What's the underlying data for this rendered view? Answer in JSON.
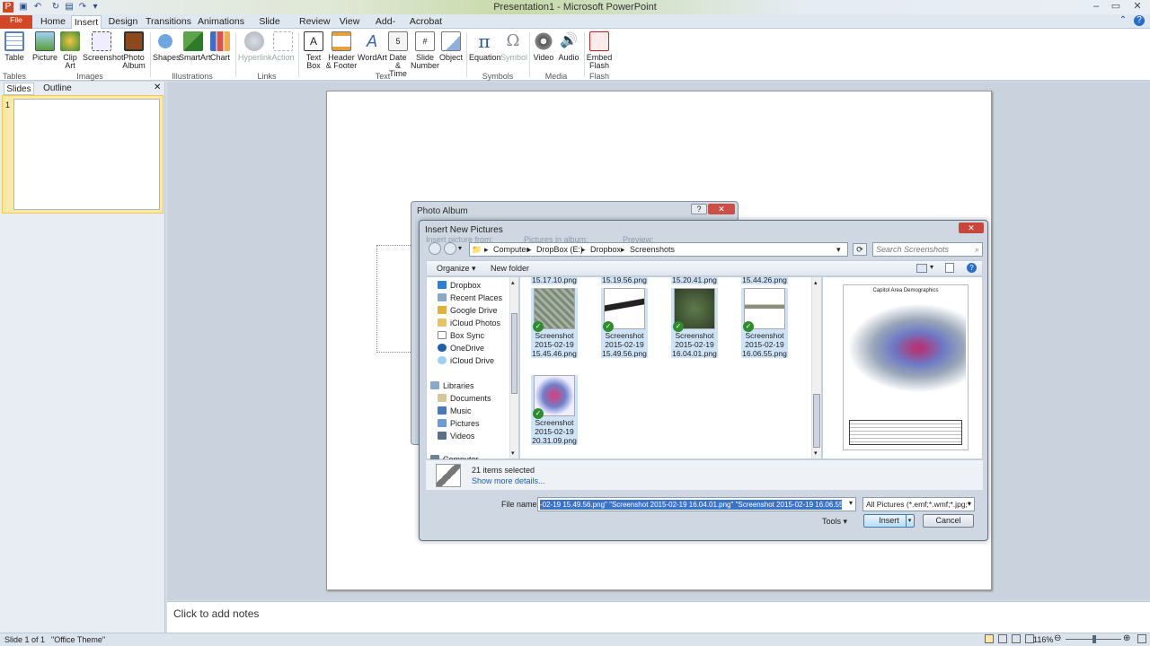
{
  "window": {
    "title": "Presentation1 - Microsoft PowerPoint"
  },
  "tabs": [
    "File",
    "Home",
    "Insert",
    "Design",
    "Transitions",
    "Animations",
    "Slide Show",
    "Review",
    "View",
    "Add-Ins",
    "Acrobat"
  ],
  "ribbon": {
    "buttons": [
      {
        "label": "Table",
        "sub": "",
        "icon": "table-icon"
      },
      {
        "label": "Picture",
        "sub": "",
        "icon": "picture-icon"
      },
      {
        "label": "Clip",
        "sub": "Art",
        "icon": "clip-art-icon"
      },
      {
        "label": "Screenshot",
        "sub": "",
        "icon": "screenshot-icon"
      },
      {
        "label": "Photo",
        "sub": "Album",
        "icon": "photo-album-icon"
      },
      {
        "label": "Shapes",
        "sub": "",
        "icon": "shapes-icon"
      },
      {
        "label": "SmartArt",
        "sub": "",
        "icon": "smartart-icon"
      },
      {
        "label": "Chart",
        "sub": "",
        "icon": "chart-icon"
      },
      {
        "label": "Hyperlink",
        "sub": "",
        "icon": "hyperlink-icon"
      },
      {
        "label": "Action",
        "sub": "",
        "icon": "action-icon"
      },
      {
        "label": "Text",
        "sub": "Box",
        "icon": "text-box-icon"
      },
      {
        "label": "Header",
        "sub": "& Footer",
        "icon": "header-footer-icon"
      },
      {
        "label": "WordArt",
        "sub": "",
        "icon": "wordart-icon"
      },
      {
        "label": "Date",
        "sub": "& Time",
        "icon": "date-time-icon"
      },
      {
        "label": "Slide",
        "sub": "Number",
        "icon": "slide-number-icon"
      },
      {
        "label": "Object",
        "sub": "",
        "icon": "object-icon"
      },
      {
        "label": "Equation",
        "sub": "",
        "icon": "equation-icon"
      },
      {
        "label": "Symbol",
        "sub": "",
        "icon": "symbol-icon"
      },
      {
        "label": "Video",
        "sub": "",
        "icon": "video-icon"
      },
      {
        "label": "Audio",
        "sub": "",
        "icon": "audio-icon"
      },
      {
        "label": "Embed",
        "sub": "Flash",
        "icon": "embed-flash-icon"
      }
    ],
    "groups": [
      "Tables",
      "Images",
      "Illustrations",
      "Links",
      "Text",
      "Symbols",
      "Media",
      "Flash"
    ]
  },
  "panes": {
    "slides_tab": "Slides",
    "outline_tab": "Outline",
    "slide_number": "1"
  },
  "notes": {
    "placeholder": "Click to add notes"
  },
  "status": {
    "slide": "Slide 1 of 1",
    "theme": "\"Office Theme\"",
    "zoom": "116%"
  },
  "album_dialog": {
    "title": "Photo Album",
    "ghost_insert": "Insert picture from:",
    "ghost_pictures": "Pictures in album:",
    "ghost_preview": "Preview:"
  },
  "insert_dialog": {
    "title": "Insert New Pictures",
    "breadcrumb": [
      "Computer",
      "DropBox (E:)",
      "Dropbox",
      "Screenshots"
    ],
    "search_placeholder": "Search Screenshots",
    "organize": "Organize",
    "new_folder": "New folder",
    "nav_items": [
      {
        "label": "Dropbox",
        "icon": "dropbox-icon"
      },
      {
        "label": "Recent Places",
        "icon": "recent-places-icon"
      },
      {
        "label": "Google Drive",
        "icon": "google-drive-icon"
      },
      {
        "label": "iCloud Photos",
        "icon": "icloud-photos-icon"
      },
      {
        "label": "Box Sync",
        "icon": "box-sync-icon"
      },
      {
        "label": "OneDrive",
        "icon": "onedrive-icon"
      },
      {
        "label": "iCloud Drive",
        "icon": "icloud-drive-icon"
      },
      {
        "label": "Libraries",
        "icon": "libraries-icon"
      },
      {
        "label": "Documents",
        "icon": "documents-icon"
      },
      {
        "label": "Music",
        "icon": "music-icon"
      },
      {
        "label": "Pictures",
        "icon": "pictures-icon"
      },
      {
        "label": "Videos",
        "icon": "videos-icon"
      },
      {
        "label": "Computer",
        "icon": "computer-icon"
      }
    ],
    "partial_names": [
      "15.17.10.png",
      "15.19.56.png",
      "15.20.41.png",
      "15.44.26.png"
    ],
    "files": [
      {
        "l1": "Screenshot",
        "l2": "2015-02-19",
        "l3": "15.45.46.png"
      },
      {
        "l1": "Screenshot",
        "l2": "2015-02-19",
        "l3": "15.49.56.png"
      },
      {
        "l1": "Screenshot",
        "l2": "2015-02-19",
        "l3": "16.04.01.png"
      },
      {
        "l1": "Screenshot",
        "l2": "2015-02-19",
        "l3": "16.06.55.png"
      },
      {
        "l1": "Screenshot",
        "l2": "2015-02-19",
        "l3": "20.31.09.png"
      }
    ],
    "preview_title": "Capitol Area Demographics",
    "selection_count": "21 items selected",
    "show_details": "Show more details...",
    "file_name_label": "File name:",
    "file_name_value": "-02-19 15.49.56.png\" \"Screenshot 2015-02-19 16.04.01.png\" \"Screenshot 2015-02-19 16.06.55.png\"",
    "file_type": "All Pictures (*.emf;*.wmf;*.jpg;*",
    "tools": "Tools",
    "insert": "Insert",
    "cancel": "Cancel"
  }
}
